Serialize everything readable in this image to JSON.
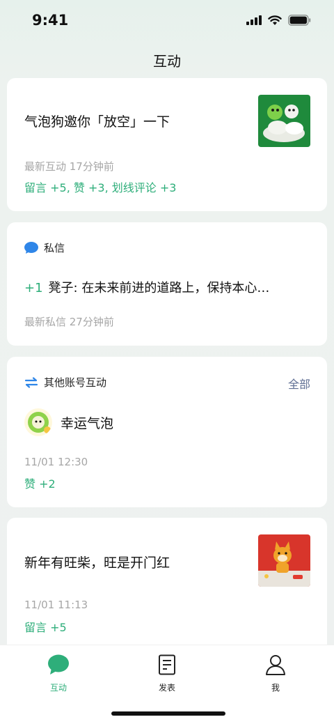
{
  "status": {
    "time": "9:41"
  },
  "nav": {
    "title": "互动"
  },
  "card1": {
    "title": "气泡狗邀你「放空」一下",
    "meta": "最新互动 17分钟前",
    "stat_comments": "留言 +5",
    "stat_likes": "赞 +3",
    "stat_highlights": "划线评论 +3",
    "separator": ","
  },
  "card2": {
    "header": "私信",
    "count": "+1",
    "message": "凳子: 在未来前进的道路上，保持本心…",
    "meta": "最新私信  27分钟前"
  },
  "card3": {
    "header": "其他账号互动",
    "see_all": "全部",
    "account_name": "幸运气泡",
    "time": "11/01 12:30",
    "stat": "赞 +2"
  },
  "card4": {
    "title": "新年有旺柴，旺是开门红",
    "time": "11/01 11:13",
    "stat": "留言 +5"
  },
  "tabbar": {
    "tabs": [
      {
        "label": "互动",
        "icon": "chat-bubble-icon",
        "active": true
      },
      {
        "label": "发表",
        "icon": "document-icon",
        "active": false
      },
      {
        "label": "我",
        "icon": "person-icon",
        "active": false
      }
    ]
  },
  "colors": {
    "accent": "#2eae7a",
    "link": "#5f6f94",
    "muted": "#a6a6a6",
    "dm_icon": "#2f86e8"
  }
}
